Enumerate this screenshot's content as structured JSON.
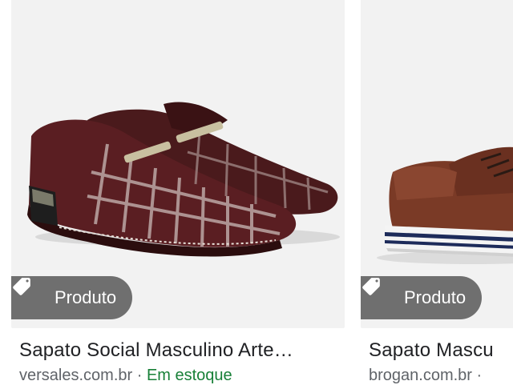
{
  "results": [
    {
      "badge": "Produto",
      "title": "Sapato Social Masculino Arte…",
      "source": "versales.com.br · ",
      "stock": "Em estoque"
    },
    {
      "badge": "Produto",
      "title": "Sapato Mascu",
      "source": "brogan.com.br ·",
      "stock": ""
    }
  ],
  "icons": {
    "badge_icon": "tag-icon"
  }
}
